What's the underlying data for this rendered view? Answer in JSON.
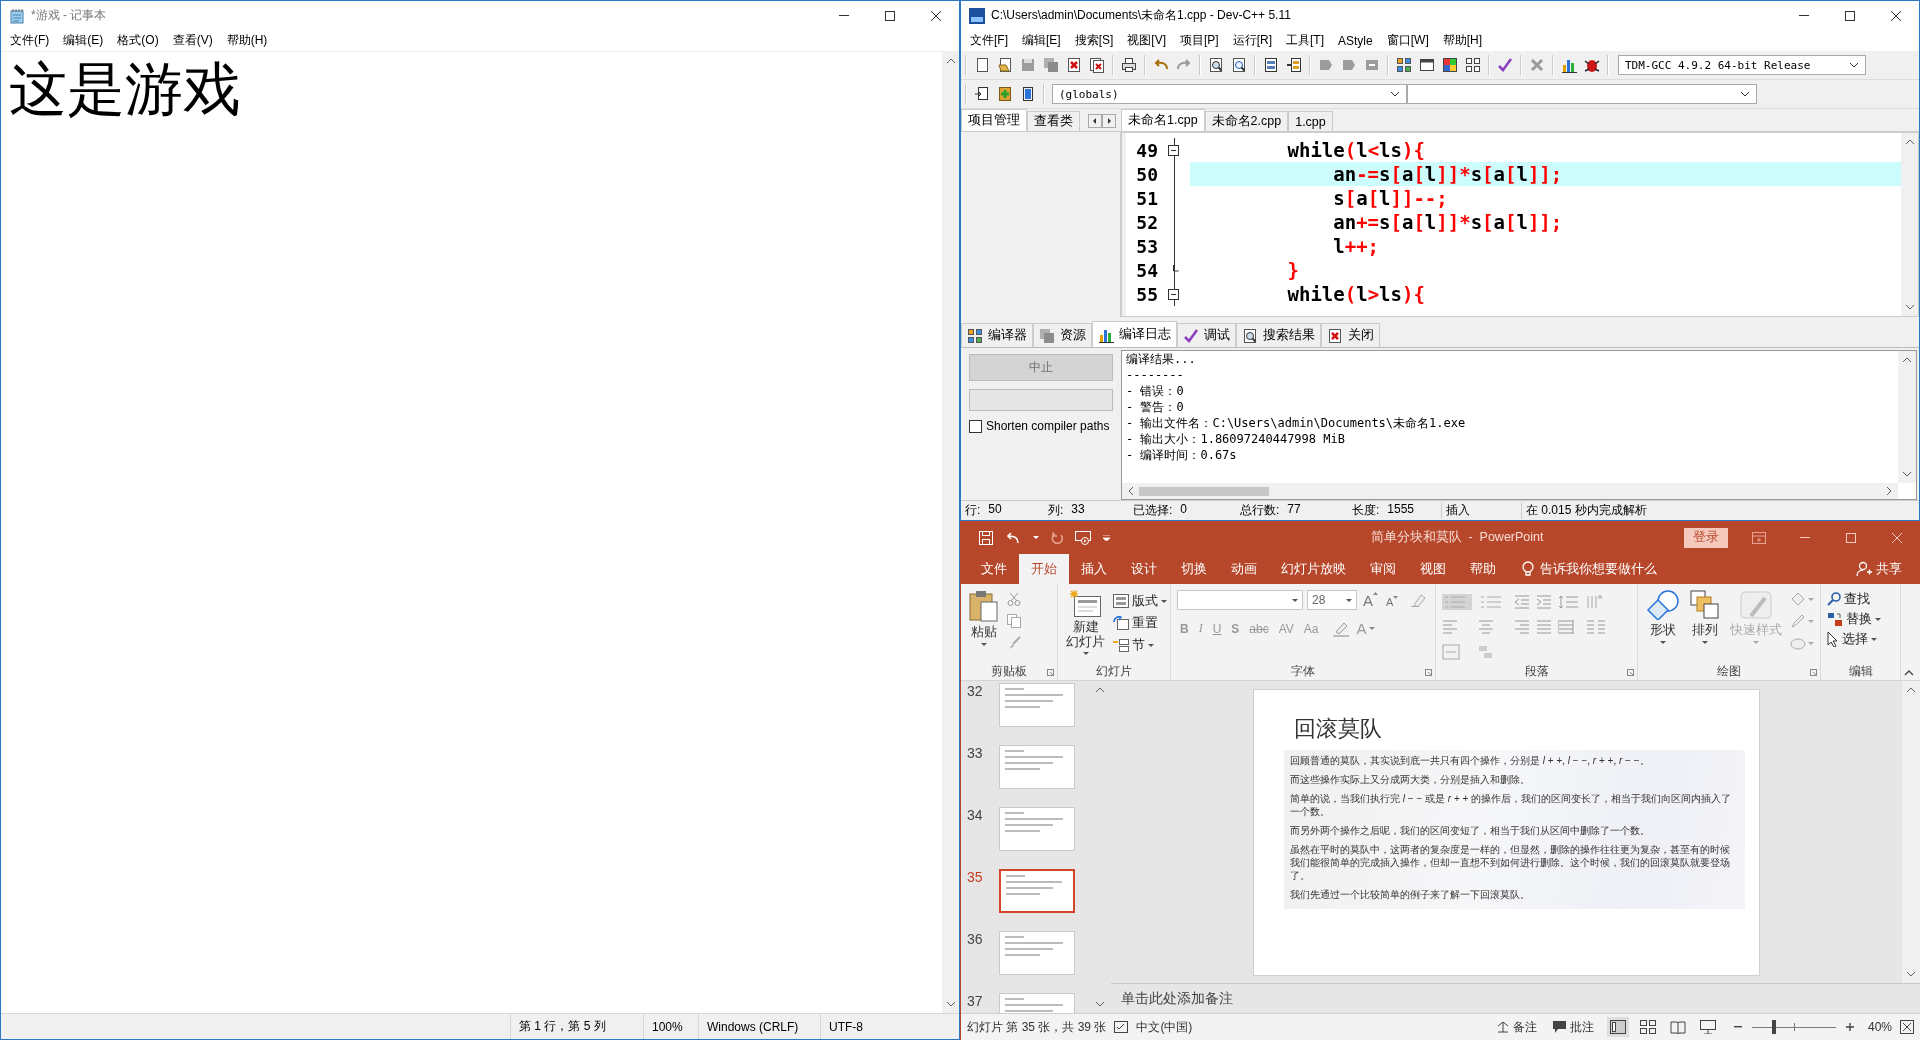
{
  "notepad": {
    "title": "*游戏 - 记事本",
    "menu": [
      "文件(F)",
      "编辑(E)",
      "格式(O)",
      "查看(V)",
      "帮助(H)"
    ],
    "text": "这是游戏",
    "status": [
      "第 1 行，第 5 列",
      "100%",
      "Windows (CRLF)",
      "UTF-8"
    ]
  },
  "devcpp": {
    "title": "C:\\Users\\admin\\Documents\\未命名1.cpp - Dev-C++ 5.11",
    "menu": [
      "文件[F]",
      "编辑[E]",
      "搜索[S]",
      "视图[V]",
      "项目[P]",
      "运行[R]",
      "工具[T]",
      "AStyle",
      "窗口[W]",
      "帮助[H]"
    ],
    "compiler": "TDM-GCC 4.9.2 64-bit Release",
    "scope": "(globals)",
    "side_tabs": [
      {
        "label": "项目管理",
        "selected": true
      },
      {
        "label": "查看类",
        "selected": false
      }
    ],
    "file_tabs": [
      {
        "label": "未命名1.cpp",
        "selected": true
      },
      {
        "label": "未命名2.cpp",
        "selected": false
      },
      {
        "label": "1.cpp",
        "selected": false
      }
    ],
    "code": [
      {
        "number": "49",
        "text": "        while(l<ls){",
        "collapsible": true,
        "block_end": false,
        "current": false
      },
      {
        "number": "50",
        "text": "            an-=s[a[l]]*s[a[l]];",
        "collapsible": false,
        "block_end": false,
        "current": true
      },
      {
        "number": "51",
        "text": "            s[a[l]]--;",
        "collapsible": false,
        "block_end": false,
        "current": false
      },
      {
        "number": "52",
        "text": "            an+=s[a[l]]*s[a[l]];",
        "collapsible": false,
        "block_end": false,
        "current": false
      },
      {
        "number": "53",
        "text": "            l++;",
        "collapsible": false,
        "block_end": false,
        "current": false
      },
      {
        "number": "54",
        "text": "        }",
        "collapsible": false,
        "block_end": true,
        "current": false
      },
      {
        "number": "55",
        "text": "        while(l>ls){",
        "collapsible": true,
        "block_end": false,
        "current": false
      }
    ],
    "panel_tabs": [
      {
        "label": "编译器",
        "selected": false
      },
      {
        "label": "资源",
        "selected": false
      },
      {
        "label": "编译日志",
        "selected": true
      },
      {
        "label": "调试",
        "selected": false
      },
      {
        "label": "搜索结果",
        "selected": false
      },
      {
        "label": "关闭",
        "selected": false
      }
    ],
    "abort_button": {
      "label": "中止",
      "disabled": true
    },
    "progress_bar": {
      "level": 0
    },
    "shorten_paths": {
      "label": "Shorten compiler paths",
      "checked": false
    },
    "log": [
      "编译结果...",
      "--------",
      "- 错误：0",
      "- 警告：0",
      "- 输出文件名：C:\\Users\\admin\\Documents\\未命名1.exe",
      "- 输出大小：1.86097240447998 MiB",
      "- 编译时间：0.67s"
    ],
    "status": [
      {
        "label": "行:",
        "value": "50"
      },
      {
        "label": "列:",
        "value": "33"
      },
      {
        "label": "已选择:",
        "value": "0"
      },
      {
        "label": "总行数:",
        "value": "77"
      },
      {
        "label": "长度:",
        "value": "1555"
      },
      {
        "label": "插入"
      },
      {
        "label": "在 0.015 秒内完成解析"
      }
    ]
  },
  "powerpoint": {
    "title": "简单分块和莫队  -  PowerPoint",
    "signin": "登录",
    "tabs": [
      {
        "label": "文件",
        "selected": false
      },
      {
        "label": "开始",
        "selected": true
      },
      {
        "label": "插入",
        "selected": false
      },
      {
        "label": "设计",
        "selected": false
      },
      {
        "label": "切换",
        "selected": false
      },
      {
        "label": "动画",
        "selected": false
      },
      {
        "label": "幻灯片放映",
        "selected": false
      },
      {
        "label": "审阅",
        "selected": false
      },
      {
        "label": "视图",
        "selected": false
      },
      {
        "label": "帮助",
        "selected": false
      }
    ],
    "tell_me": "告诉我你想要做什么",
    "share": "共享",
    "clipboard": {
      "label": "剪贴板",
      "paste": "粘贴"
    },
    "slides_group": {
      "label": "幻灯片",
      "new_slide": [
        "新建",
        "幻灯片"
      ],
      "layout": "版式",
      "reset": "重置",
      "section": "节"
    },
    "font": {
      "label": "字体",
      "size": "28",
      "size_buttons": [
        "A",
        "A"
      ],
      "format_buttons": [
        "B",
        "I",
        "U",
        "S",
        "abc",
        "AV",
        "Aa"
      ],
      "color_button": "A"
    },
    "paragraph": {
      "label": "段落"
    },
    "drawing": {
      "label": "绘图",
      "shapes": "形状",
      "arrange": "排列",
      "quick_styles": {
        "label": "快速样式",
        "disabled": true
      }
    },
    "editing": {
      "label": "编辑",
      "find": "查找",
      "replace": "替换",
      "select": "选择"
    },
    "slides": [
      {
        "number": "32",
        "selected": false
      },
      {
        "number": "33",
        "selected": false
      },
      {
        "number": "34",
        "selected": false
      },
      {
        "number": "35",
        "selected": true
      },
      {
        "number": "36",
        "selected": false
      },
      {
        "number": "37",
        "selected": false
      }
    ],
    "slide": {
      "title": "回滚莫队",
      "paragraphs": [
        "回顾普通的莫队，其实说到底一共只有四个操作，分别是 *l* + +, *l* − −, *r* + +, *r* − −。",
        "而这些操作实际上又分成两大类，分别是插入和删除。",
        "简单的说，当我们执行完 *l* − − 或是 *r* + + 的操作后，我们的区间变长了，相当于我们向区间内插入了一个数。",
        "而另外两个操作之后呢，我们的区间变短了，相当于我们从区间中删除了一个数。",
        "虽然在平时的莫队中，这两者的复杂度是一样的，但显然，删除的操作往往更为复杂，甚至有的时候我们能很简单的完成插入操作，但却一直想不到如何进行删除。这个时候，我们的回滚莫队就要登场了。",
        "我们先通过一个比较简单的例子来了解一下回滚莫队。"
      ]
    },
    "notes_placeholder": "单击此处添加备注",
    "status": {
      "slide_info": "幻灯片 第 35 张，共 39 张",
      "language": "中文(中国)",
      "notes": "备注",
      "comments": "批注",
      "zoom": "40%",
      "zoom_slider": {
        "level": 0.25
      }
    }
  }
}
